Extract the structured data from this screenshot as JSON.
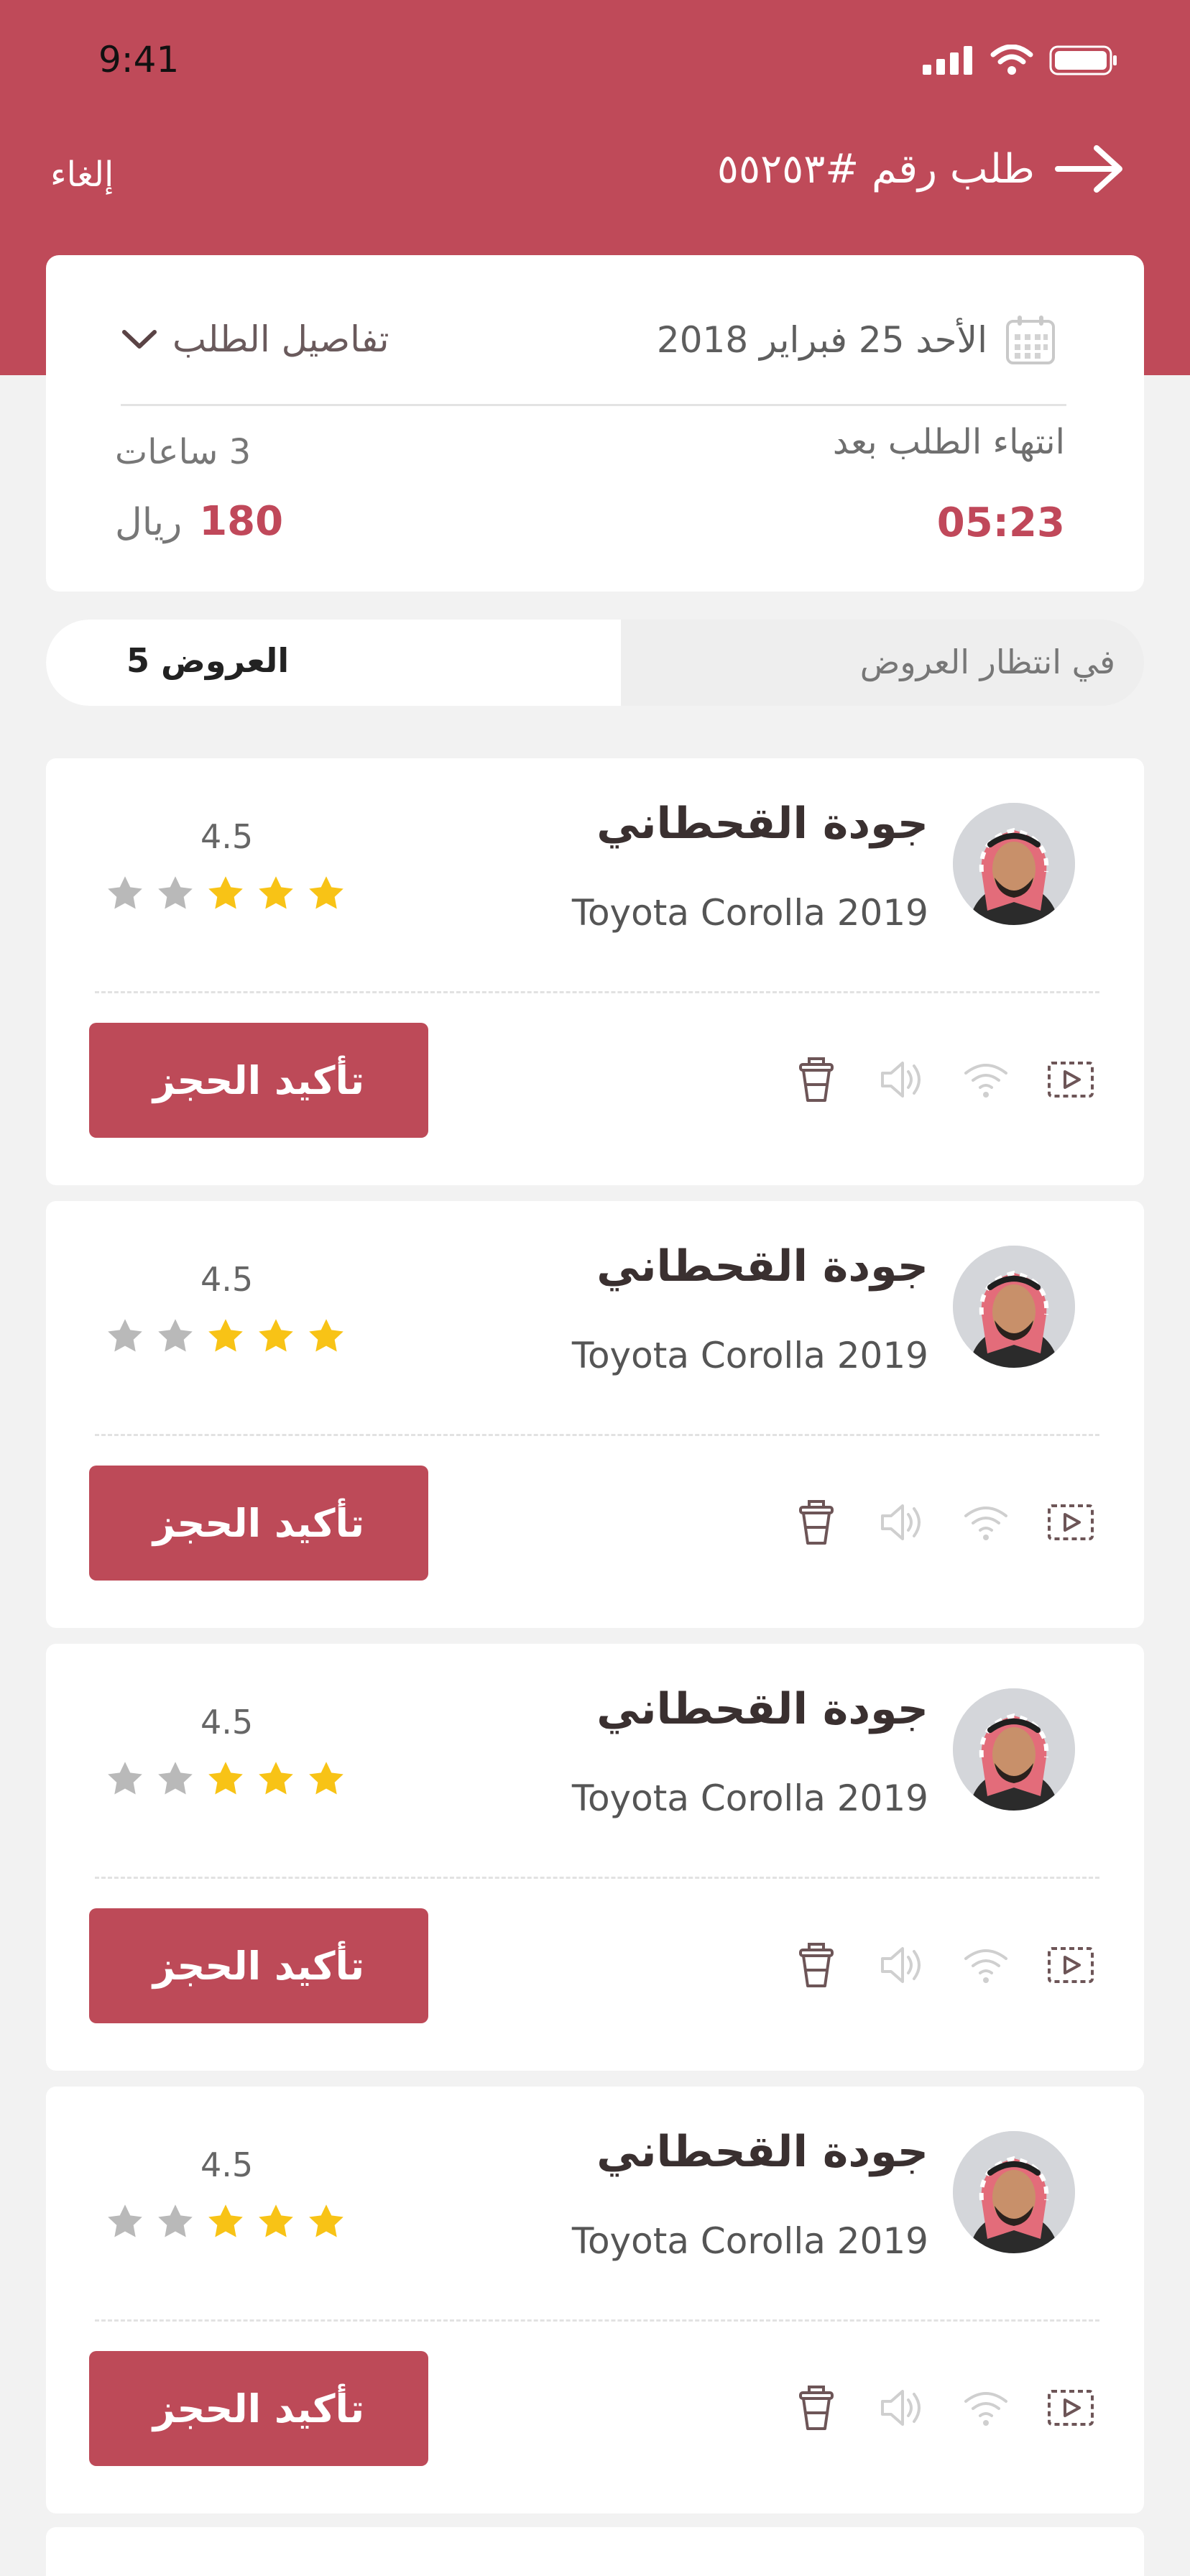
{
  "status_bar": {
    "time": "9:41"
  },
  "nav": {
    "cancel_label": "إلغاء",
    "title": "طلب رقم #٥٥٢٥٣"
  },
  "request": {
    "date": "الأحد 25 فبراير 2018",
    "details_label": "تفاصيل الطلب",
    "expire_label": "انتهاء الطلب بعد",
    "timer": "05:23",
    "hours": "3 ساعات",
    "price": "180",
    "currency": "ريال"
  },
  "segments": {
    "offers_label": "العروض 5",
    "waiting_label": "في انتظار العروض"
  },
  "offers": [
    {
      "driver_name": "جودة القحطاني",
      "car": "Toyota Corolla 2019",
      "rating": "4.5",
      "stars_filled": 3,
      "stars_total": 5,
      "confirm_label": "تأكيد الحجز"
    },
    {
      "driver_name": "جودة القحطاني",
      "car": "Toyota Corolla 2019",
      "rating": "4.5",
      "stars_filled": 3,
      "stars_total": 5,
      "confirm_label": "تأكيد الحجز"
    },
    {
      "driver_name": "جودة القحطاني",
      "car": "Toyota Corolla 2019",
      "rating": "4.5",
      "stars_filled": 3,
      "stars_total": 5,
      "confirm_label": "تأكيد الحجز"
    },
    {
      "driver_name": "جودة القحطاني",
      "car": "Toyota Corolla 2019",
      "rating": "4.5",
      "stars_filled": 3,
      "stars_total": 5,
      "confirm_label": "تأكيد الحجز"
    }
  ],
  "feature_icons": [
    "video-icon",
    "wifi-icon",
    "speaker-icon",
    "cup-icon"
  ],
  "colors": {
    "primary": "#bf4a59",
    "accent_text": "#c0485a",
    "star_filled": "#f8c316",
    "star_empty": "#b9b9b9"
  }
}
